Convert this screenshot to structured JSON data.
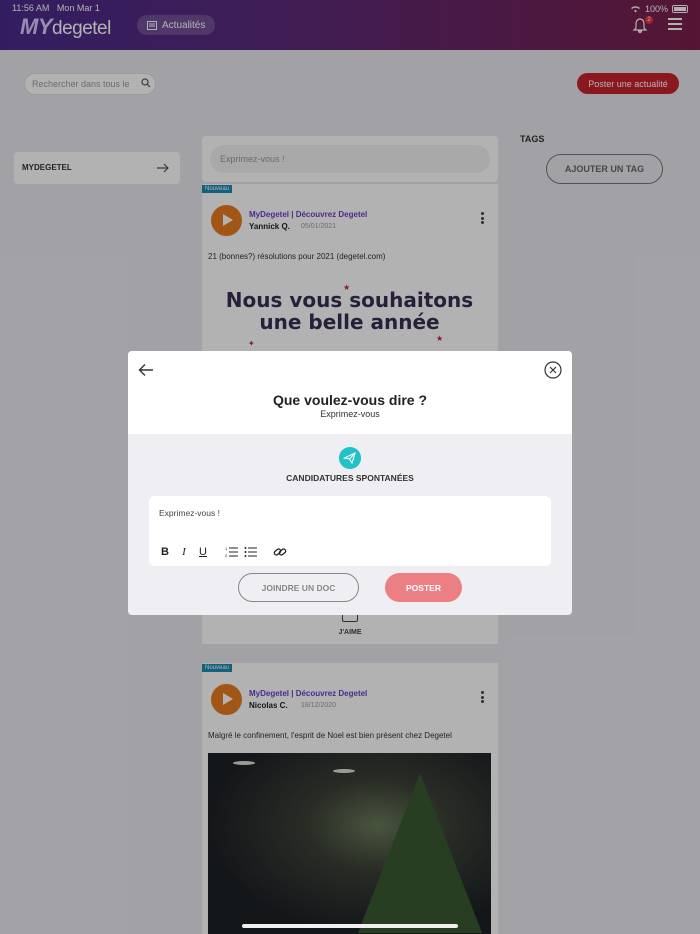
{
  "status_bar": {
    "time": "11:56 AM",
    "date": "Mon Mar 1",
    "battery": "100%"
  },
  "header": {
    "logo_my": "MY",
    "logo_brand": "degetel",
    "nav_label": "Actualités",
    "notification_count": "2"
  },
  "toolbar": {
    "search_placeholder": "Rechercher dans tous le",
    "post_news_label": "Poster une actualité"
  },
  "sidebar": {
    "label": "MYDEGETEL"
  },
  "tags": {
    "title": "TAGS",
    "add_label": "AJOUTER UN TAG"
  },
  "feed": {
    "compose_placeholder": "Exprimez-vous !",
    "posts": [
      {
        "badge": "Nouveau",
        "channel": "MyDegetel | Découvrez Degetel",
        "author": "Yannick Q.",
        "date": "05/01/2021",
        "text": "21 (bonnes?) résolutions pour 2021 (degetel.com)",
        "image_line1": "Nous vous souhaitons",
        "image_line2": "une belle année",
        "like_label": "J'AIME"
      },
      {
        "badge": "Nouveau",
        "channel": "MyDegetel | Découvrez Degetel",
        "author": "Nicolas C.",
        "date": "18/12/2020",
        "text": "Malgré le confinement, l'esprit de Noel est bien présent chez Degetel"
      }
    ]
  },
  "modal": {
    "title": "Que voulez-vous dire ?",
    "subtitle": "Exprimez-vous",
    "channel_label": "CANDIDATURES SPONTANÉES",
    "editor_placeholder": "Exprimez-vous !",
    "toolbar": {
      "bold": "B",
      "italic": "I",
      "underline": "U"
    },
    "attach_label": "JOINDRE UN DOC",
    "post_label": "POSTER"
  },
  "colors": {
    "header_start": "#4a2a8c",
    "header_end": "#7a1f4a",
    "accent_red": "#c8212d",
    "post_button": "#ec7f83",
    "channel_teal": "#21c3c9",
    "badge_blue": "#1d8bb5",
    "channel_purple": "#6a40c9"
  },
  "icons": [
    "wifi-icon",
    "battery-icon",
    "news-icon",
    "bell-icon",
    "menu-icon",
    "search-icon",
    "arrow-right-icon",
    "more-vertical-icon",
    "like-icon",
    "back-arrow-icon",
    "close-circle-icon",
    "paper-plane-icon",
    "bold-icon",
    "italic-icon",
    "underline-icon",
    "ordered-list-icon",
    "bullet-list-icon",
    "link-icon"
  ]
}
